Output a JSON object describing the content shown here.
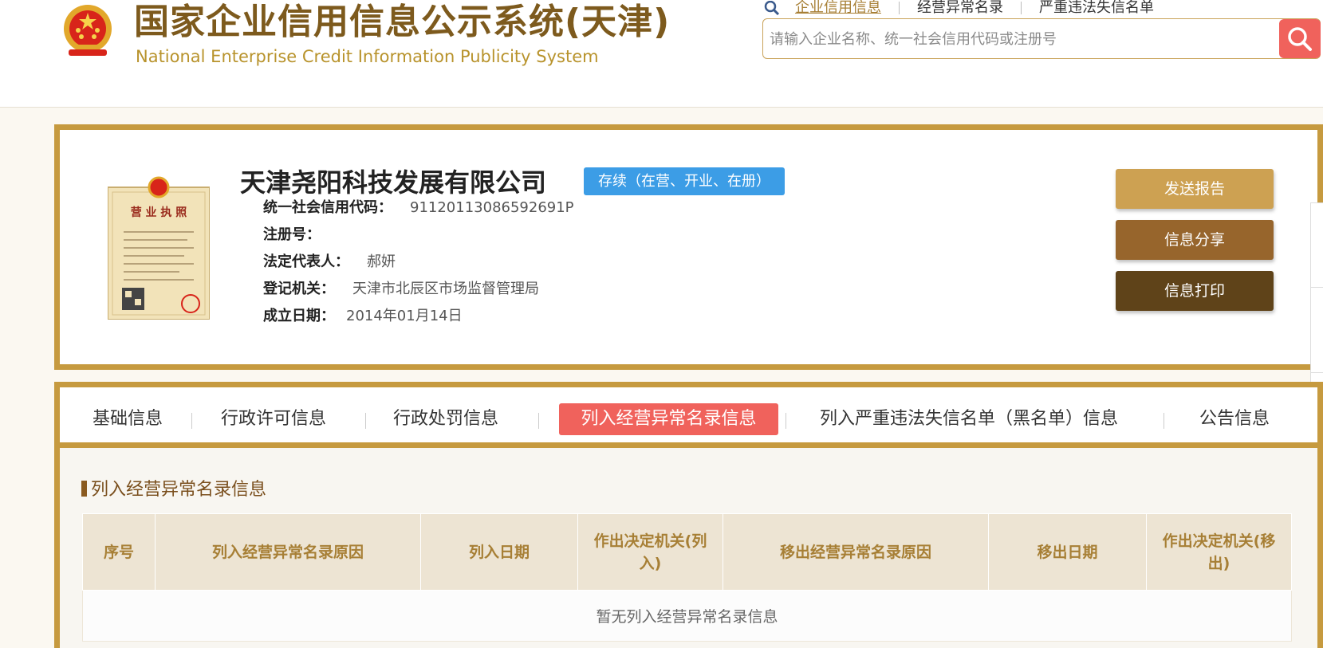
{
  "header": {
    "title_cn": "国家企业信用信息公示系统(天津)",
    "title_en": "National Enterprise Credit Information Publicity System",
    "emblem_icon": "national-emblem-icon",
    "top_links": [
      "企业信用信息",
      "经营异常名录",
      "严重违法失信名单"
    ],
    "search": {
      "placeholder": "请输入企业名称、统一社会信用代码或注册号",
      "value": "",
      "button_icon": "search-icon"
    }
  },
  "company": {
    "name": "天津尧阳科技发展有限公司",
    "status": "存续（在营、开业、在册）",
    "license_icon": "business-license-icon",
    "fields": [
      {
        "label": "统一社会信用代码：",
        "value": "91120113086592691P"
      },
      {
        "label": "注册号：",
        "value": ""
      },
      {
        "label": "法定代表人：",
        "value": "郝妍"
      },
      {
        "label": "登记机关：",
        "value": "天津市北辰区市场监督管理局"
      },
      {
        "label": "成立日期：",
        "value": "2014年01月14日"
      }
    ],
    "actions": [
      "发送报告",
      "信息分享",
      "信息打印"
    ]
  },
  "tabs": [
    "基础信息",
    "行政许可信息",
    "行政处罚信息",
    "列入经营异常名录信息",
    "列入严重违法失信名单（黑名单）信息",
    "公告信息"
  ],
  "active_tab": "列入经营异常名录信息",
  "section": {
    "title": "列入经营异常名录信息",
    "columns": [
      "序号",
      "列入经营异常名录原因",
      "列入日期",
      "作出决定机关(列入)",
      "移出经营异常名录原因",
      "移出日期",
      "作出决定机关(移出)"
    ],
    "empty_text": "暂无列入经营异常名录信息"
  },
  "colors": {
    "gold_border": "#c69a3f",
    "brand_brown": "#7d5a1d",
    "accent_red": "#f0625c",
    "status_blue": "#3c9de6"
  }
}
